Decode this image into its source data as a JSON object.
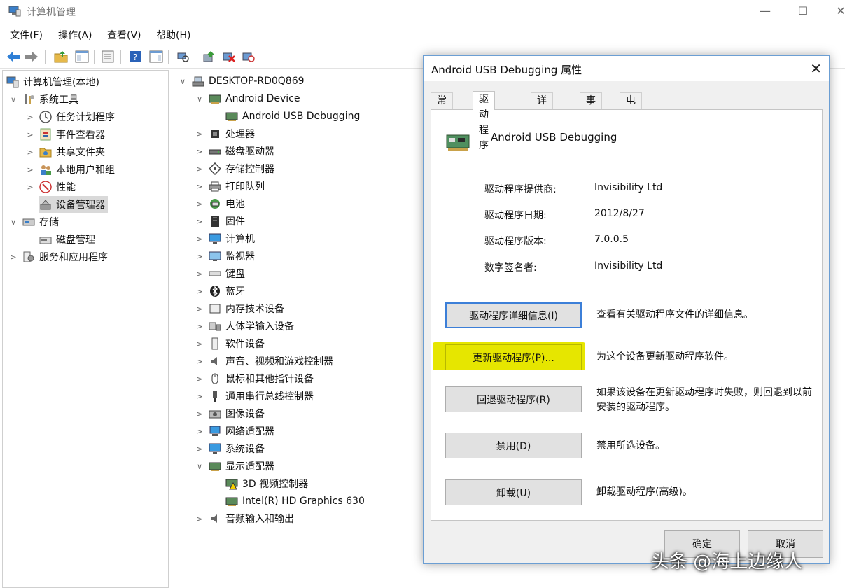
{
  "window": {
    "title": "计算机管理",
    "controls": {
      "minimize": "—",
      "maximize": "☐",
      "close": "✕"
    }
  },
  "menubar": [
    "文件(F)",
    "操作(A)",
    "查看(V)",
    "帮助(H)"
  ],
  "toolbar": {
    "icons": [
      "back-arrow-icon",
      "forward-arrow-icon",
      "up-folder-icon",
      "show-tree-icon",
      "properties-icon",
      "help-icon",
      "action-pane-icon",
      "scan-hardware-icon",
      "update-driver-icon",
      "uninstall-device-icon",
      "disable-device-icon"
    ]
  },
  "left_tree": {
    "items": [
      {
        "label": "计算机管理(本地)",
        "level": 0,
        "expander": "",
        "icon": "computer-management-icon"
      },
      {
        "label": "系统工具",
        "level": 0,
        "expander": "∨",
        "icon": "system-tools-icon"
      },
      {
        "label": "任务计划程序",
        "level": 1,
        "expander": ">",
        "icon": "clock-icon"
      },
      {
        "label": "事件查看器",
        "level": 1,
        "expander": ">",
        "icon": "event-viewer-icon"
      },
      {
        "label": "共享文件夹",
        "level": 1,
        "expander": ">",
        "icon": "shared-folder-icon"
      },
      {
        "label": "本地用户和组",
        "level": 1,
        "expander": ">",
        "icon": "users-icon"
      },
      {
        "label": "性能",
        "level": 1,
        "expander": ">",
        "icon": "performance-icon"
      },
      {
        "label": "设备管理器",
        "level": 1,
        "expander": "",
        "icon": "device-manager-icon",
        "selected": true
      },
      {
        "label": "存储",
        "level": 0,
        "expander": "∨",
        "icon": "storage-icon"
      },
      {
        "label": "磁盘管理",
        "level": 1,
        "expander": "",
        "icon": "disk-management-icon"
      },
      {
        "label": "服务和应用程序",
        "level": 0,
        "expander": ">",
        "icon": "services-icon"
      }
    ]
  },
  "device_tree": {
    "items": [
      {
        "label": "DESKTOP-RD0Q869",
        "level": 0,
        "expander": "∨",
        "icon": "computer-icon"
      },
      {
        "label": "Android Device",
        "level": 1,
        "expander": "∨",
        "icon": "device-card-icon"
      },
      {
        "label": "Android USB Debugging",
        "level": 2,
        "expander": "",
        "icon": "device-card-icon"
      },
      {
        "label": "处理器",
        "level": 1,
        "expander": ">",
        "icon": "processor-icon"
      },
      {
        "label": "磁盘驱动器",
        "level": 1,
        "expander": ">",
        "icon": "disk-drive-icon"
      },
      {
        "label": "存储控制器",
        "level": 1,
        "expander": ">",
        "icon": "storage-controller-icon"
      },
      {
        "label": "打印队列",
        "level": 1,
        "expander": ">",
        "icon": "printer-icon"
      },
      {
        "label": "电池",
        "level": 1,
        "expander": ">",
        "icon": "battery-icon"
      },
      {
        "label": "固件",
        "level": 1,
        "expander": ">",
        "icon": "firmware-icon"
      },
      {
        "label": "计算机",
        "level": 1,
        "expander": ">",
        "icon": "monitor-icon"
      },
      {
        "label": "监视器",
        "level": 1,
        "expander": ">",
        "icon": "monitor-icon"
      },
      {
        "label": "键盘",
        "level": 1,
        "expander": ">",
        "icon": "keyboard-icon"
      },
      {
        "label": "蓝牙",
        "level": 1,
        "expander": ">",
        "icon": "bluetooth-icon"
      },
      {
        "label": "内存技术设备",
        "level": 1,
        "expander": ">",
        "icon": "memory-icon"
      },
      {
        "label": "人体学输入设备",
        "level": 1,
        "expander": ">",
        "icon": "hid-icon"
      },
      {
        "label": "软件设备",
        "level": 1,
        "expander": ">",
        "icon": "software-device-icon"
      },
      {
        "label": "声音、视频和游戏控制器",
        "level": 1,
        "expander": ">",
        "icon": "speaker-icon"
      },
      {
        "label": "鼠标和其他指针设备",
        "level": 1,
        "expander": ">",
        "icon": "mouse-icon"
      },
      {
        "label": "通用串行总线控制器",
        "level": 1,
        "expander": ">",
        "icon": "usb-icon"
      },
      {
        "label": "图像设备",
        "level": 1,
        "expander": ">",
        "icon": "camera-icon"
      },
      {
        "label": "网络适配器",
        "level": 1,
        "expander": ">",
        "icon": "network-icon"
      },
      {
        "label": "系统设备",
        "level": 1,
        "expander": ">",
        "icon": "monitor-icon"
      },
      {
        "label": "显示适配器",
        "level": 1,
        "expander": "∨",
        "icon": "device-card-icon"
      },
      {
        "label": "3D 视频控制器",
        "level": 2,
        "expander": "",
        "icon": "warning-card-icon"
      },
      {
        "label": "Intel(R) HD Graphics 630",
        "level": 2,
        "expander": "",
        "icon": "device-card-icon"
      },
      {
        "label": "音频输入和输出",
        "level": 1,
        "expander": ">",
        "icon": "speaker-icon"
      }
    ]
  },
  "dialog": {
    "title": "Android USB Debugging 属性",
    "close": "✕",
    "tabs": [
      "常规",
      "驱动程序",
      "详细信息",
      "事件",
      "电源管理"
    ],
    "active_tab": "驱动程序",
    "device_name": "Android USB Debugging",
    "properties": [
      {
        "label": "驱动程序提供商:",
        "value": "Invisibility Ltd"
      },
      {
        "label": "驱动程序日期:",
        "value": "2012/8/27"
      },
      {
        "label": "驱动程序版本:",
        "value": "7.0.0.5"
      },
      {
        "label": "数字签名者:",
        "value": "Invisibility Ltd"
      }
    ],
    "actions": [
      {
        "label": "驱动程序详细信息(I)",
        "desc": "查看有关驱动程序文件的详细信息。",
        "name": "driver-details-button"
      },
      {
        "label": "更新驱动程序(P)...",
        "desc": "为这个设备更新驱动程序软件。",
        "name": "update-driver-button"
      },
      {
        "label": "回退驱动程序(R)",
        "desc": "如果该设备在更新驱动程序时失败，则回退到以前安装的驱动程序。",
        "name": "rollback-driver-button"
      },
      {
        "label": "禁用(D)",
        "desc": "禁用所选设备。",
        "name": "disable-device-button"
      },
      {
        "label": "卸载(U)",
        "desc": "卸载驱动程序(高级)。",
        "name": "uninstall-driver-button"
      }
    ],
    "ok": "确定",
    "cancel": "取消"
  },
  "watermark": "头条 @海上边缘人",
  "colors": {
    "highlight": "#e6e600",
    "focus_border": "#3c7fd8",
    "dialog_border": "#6b9ed3",
    "selection": "#d9d9d9"
  }
}
